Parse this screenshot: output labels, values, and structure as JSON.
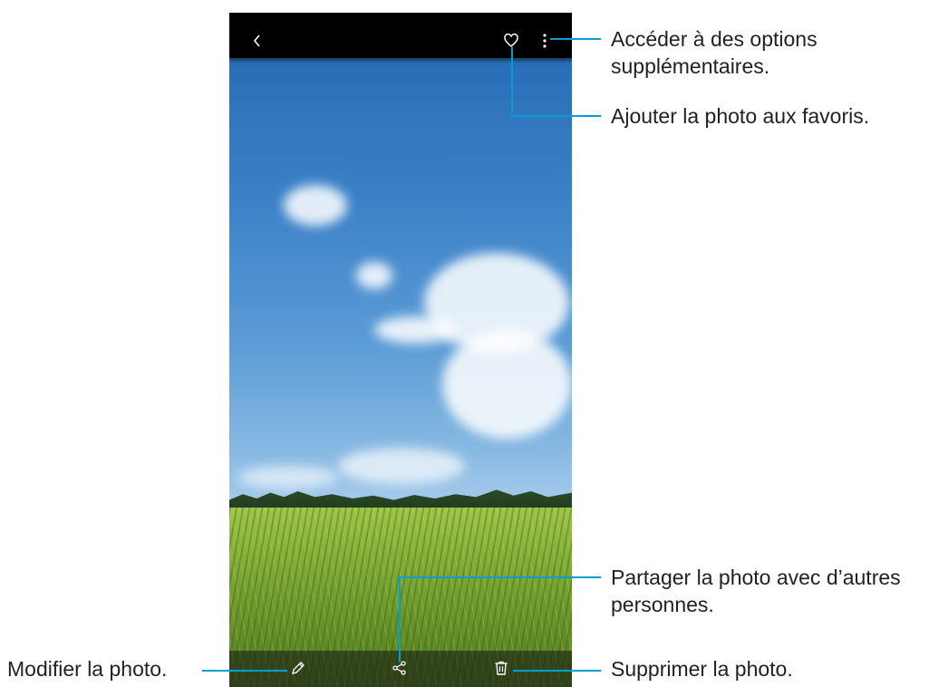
{
  "callouts": {
    "more_options": {
      "line1": "Accéder à des options",
      "line2": "supplémentaires."
    },
    "favorite": "Ajouter la photo aux favoris.",
    "share": {
      "line1": "Partager la photo avec d’autres",
      "line2": "personnes."
    },
    "edit": "Modifier la photo.",
    "delete": "Supprimer la photo."
  },
  "icons": {
    "top_bar": [
      "back-icon",
      "heart-icon",
      "more-options-icon"
    ],
    "bottom_bar": [
      "edit-icon",
      "share-icon",
      "delete-icon"
    ]
  },
  "colors": {
    "callout_line": "#009fd8",
    "screen_bars": "#000000"
  }
}
